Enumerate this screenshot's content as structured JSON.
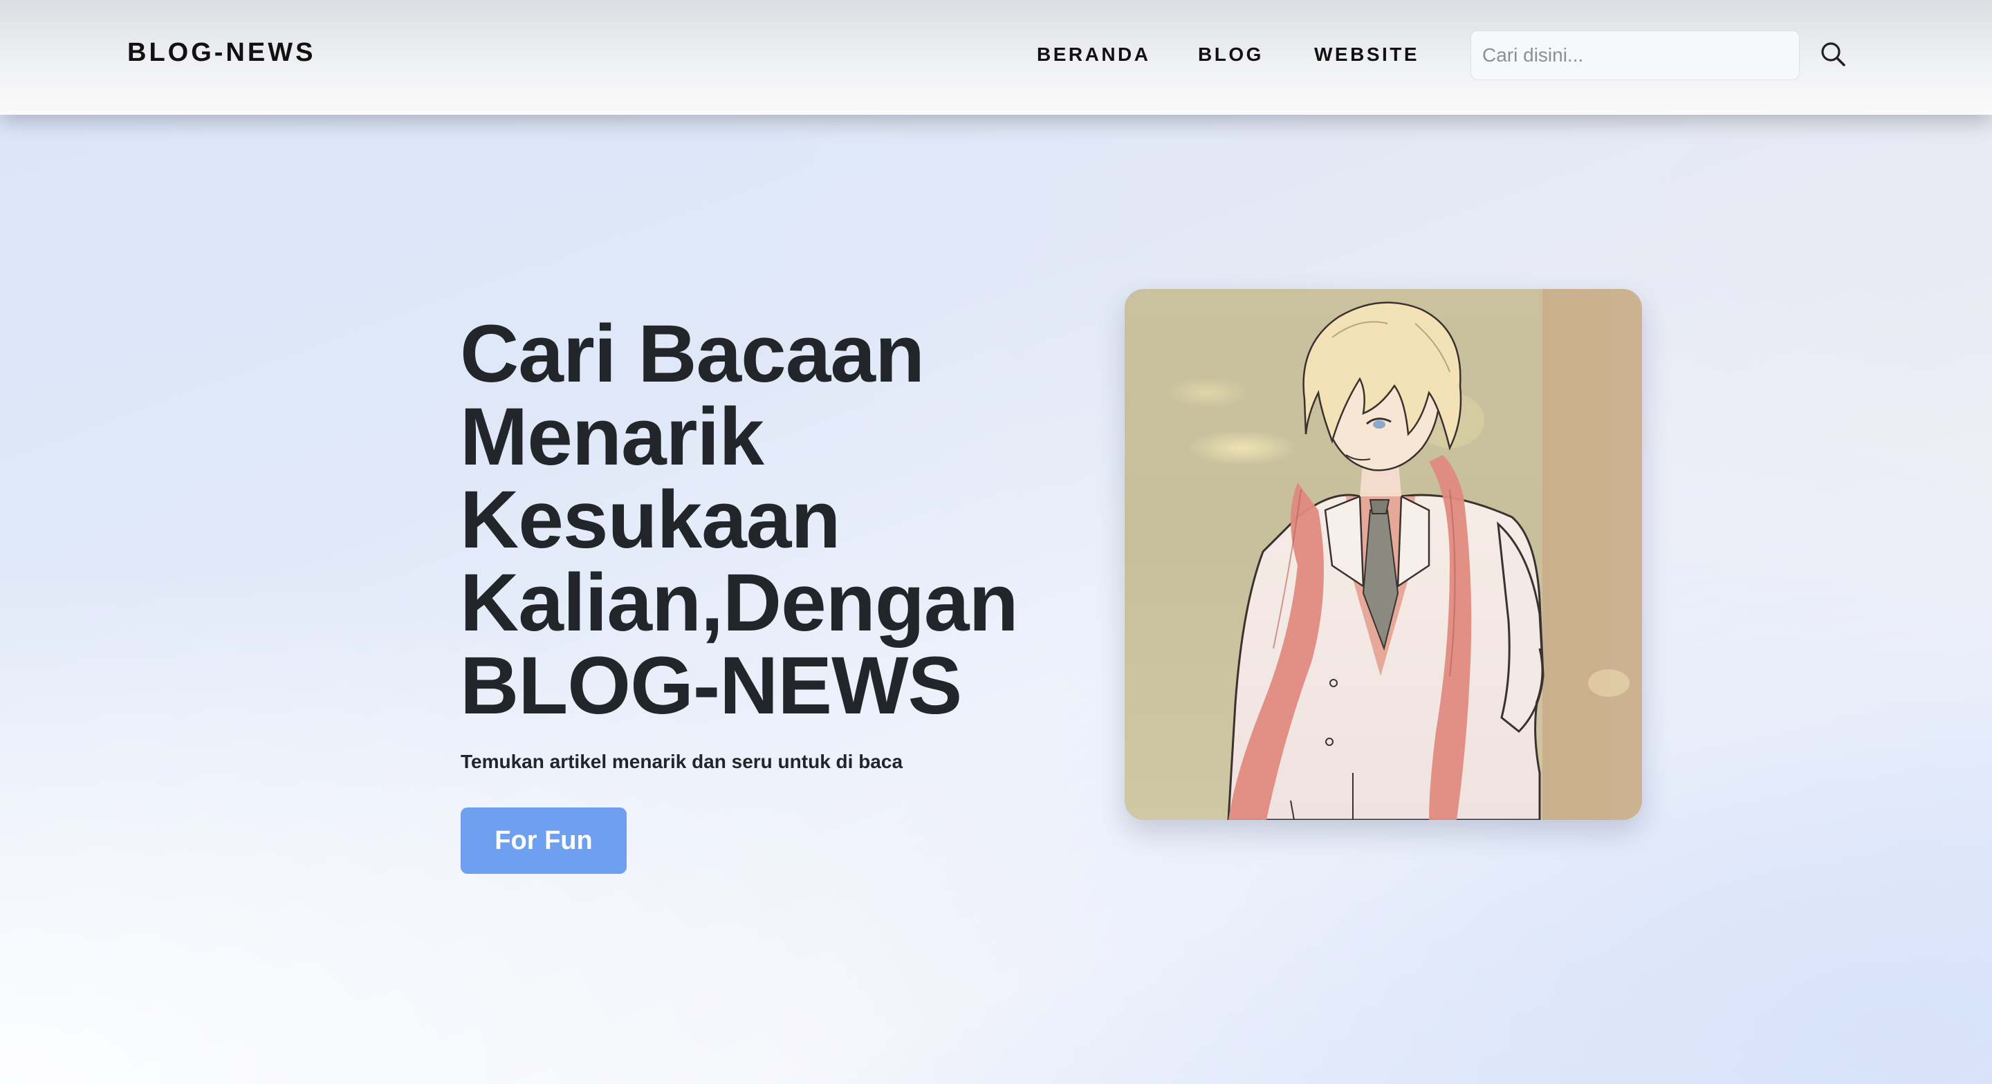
{
  "navbar": {
    "brand": "BLOG-NEWS",
    "links": [
      "BERANDA",
      "BLOG",
      "WEBSITE"
    ],
    "search": {
      "placeholder": "Cari disini...",
      "icon": "search-icon"
    }
  },
  "hero": {
    "title_lines": [
      "Cari Bacaan",
      "Menarik",
      "Kesukaan",
      "Kalian,Dengan",
      "BLOG-NEWS"
    ],
    "subtitle": "Temukan artikel menarik dan seru untuk di baca",
    "cta_label": "For Fun"
  },
  "colors": {
    "accent": "#6fa0f0",
    "text": "#22262b",
    "navbar": "#f1f2f4"
  }
}
